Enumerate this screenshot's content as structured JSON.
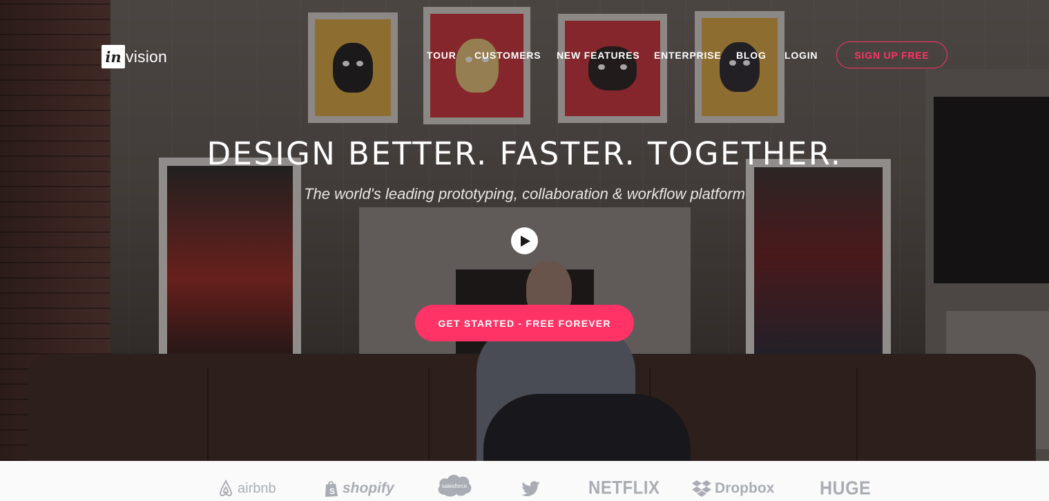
{
  "brand": {
    "logo_mark": "in",
    "logo_text": "vision",
    "accent_color": "#ff3366"
  },
  "nav": {
    "links": [
      "TOUR",
      "CUSTOMERS",
      "NEW FEATURES",
      "ENTERPRISE",
      "BLOG",
      "LOGIN"
    ],
    "signup_label": "SIGN UP FREE"
  },
  "hero": {
    "headline": "DESIGN BETTER. FASTER. TOGETHER.",
    "subheadline": "The world's leading prototyping, collaboration & workflow platform",
    "play_icon": "play-icon",
    "cta_label": "GET STARTED - FREE FOREVER"
  },
  "clients": {
    "logos": [
      "airbnb",
      "shopify",
      "salesforce",
      "twitter",
      "NETFLIX",
      "Dropbox",
      "HUGE"
    ],
    "color": "#a9adb3"
  }
}
